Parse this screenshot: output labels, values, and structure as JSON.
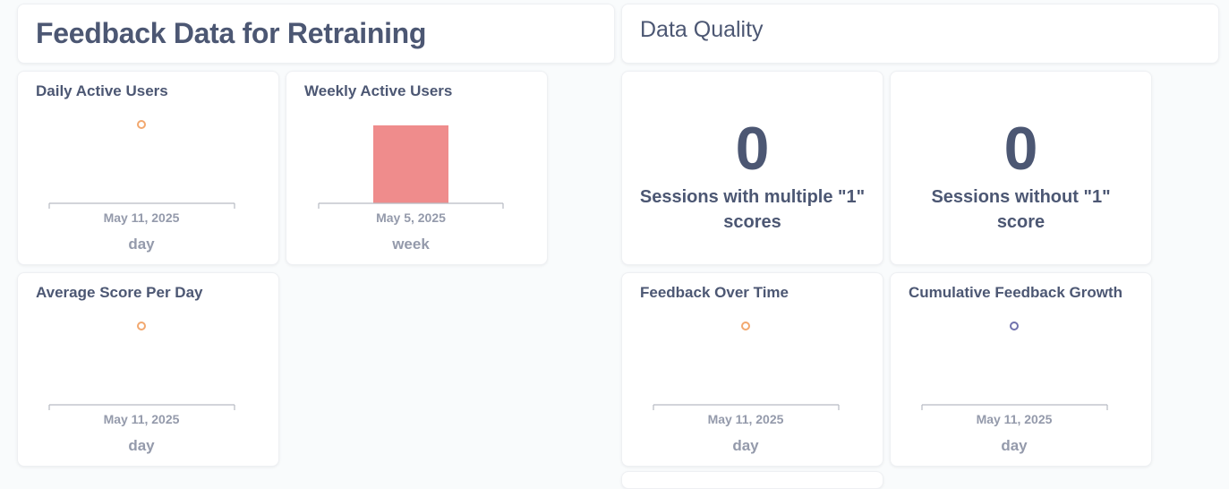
{
  "headings": {
    "left_title": "Feedback Data for Retraining",
    "right_title": "Data Quality"
  },
  "cards": {
    "daily_active_users": {
      "title": "Daily Active Users",
      "x_tick": "May 11, 2025",
      "x_axis_label": "day",
      "color": "#f2a86f"
    },
    "weekly_active_users": {
      "title": "Weekly Active Users",
      "x_tick": "May 5, 2025",
      "x_axis_label": "week",
      "color": "#ef8c8c"
    },
    "average_score_per_day": {
      "title": "Average Score Per Day",
      "x_tick": "May 11, 2025",
      "x_axis_label": "day",
      "color": "#f2a86f"
    },
    "sessions_multiple_1": {
      "value": "0",
      "label": "Sessions with multiple \"1\" scores"
    },
    "sessions_without_1": {
      "value": "0",
      "label": "Sessions without \"1\" score"
    },
    "feedback_over_time": {
      "title": "Feedback Over Time",
      "x_tick": "May 11, 2025",
      "x_axis_label": "day",
      "color": "#f2a86f"
    },
    "cumulative_feedback_growth": {
      "title": "Cumulative Feedback Growth",
      "x_tick": "May 11, 2025",
      "x_axis_label": "day",
      "color": "#7172ad"
    }
  },
  "chart_data": [
    {
      "type": "line",
      "x": [
        "May 11, 2025"
      ],
      "series": [
        {
          "values": [
            null
          ]
        }
      ],
      "xlabel": "day",
      "title": "Daily Active Users"
    },
    {
      "type": "bar",
      "categories": [
        "May 5, 2025"
      ],
      "values": [
        null
      ],
      "xlabel": "week",
      "title": "Weekly Active Users"
    },
    {
      "type": "line",
      "x": [
        "May 11, 2025"
      ],
      "series": [
        {
          "values": [
            null
          ]
        }
      ],
      "xlabel": "day",
      "title": "Average Score Per Day"
    },
    {
      "type": "line",
      "x": [
        "May 11, 2025"
      ],
      "series": [
        {
          "values": [
            null
          ]
        }
      ],
      "xlabel": "day",
      "title": "Feedback Over Time"
    },
    {
      "type": "line",
      "x": [
        "May 11, 2025"
      ],
      "series": [
        {
          "values": [
            null
          ]
        }
      ],
      "xlabel": "day",
      "title": "Cumulative Feedback Growth"
    }
  ]
}
